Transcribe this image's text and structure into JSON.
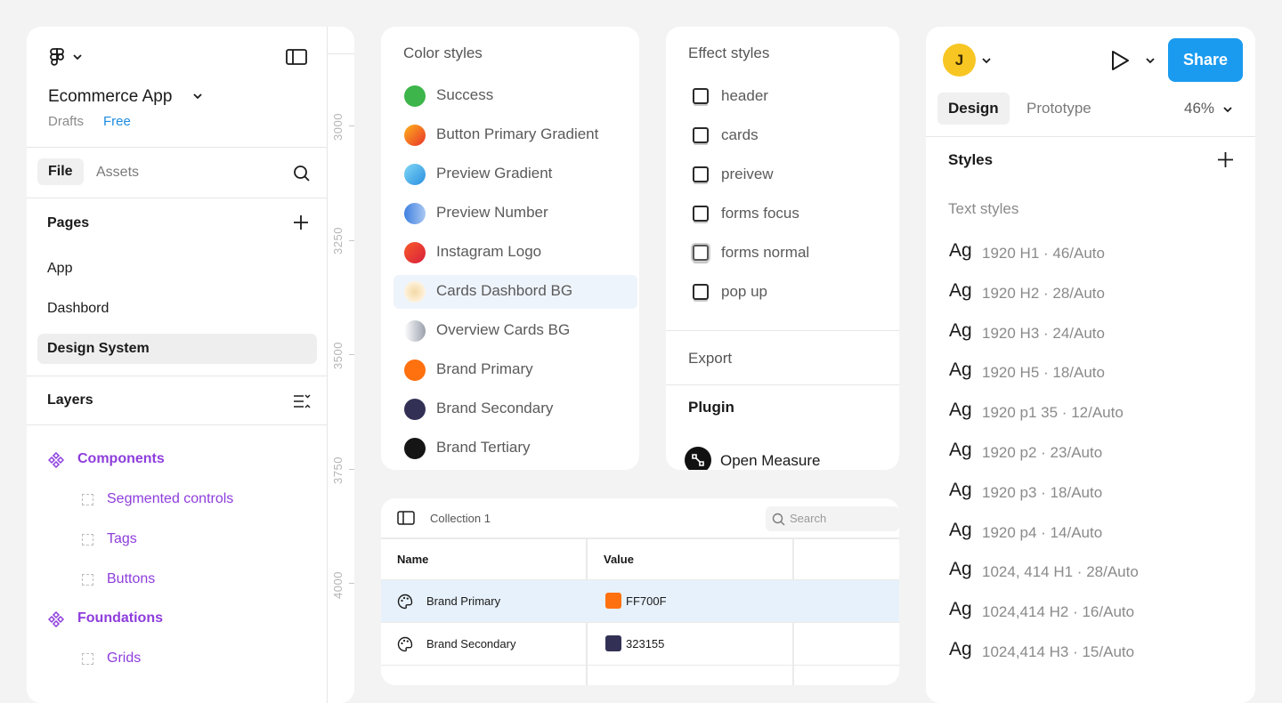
{
  "left_panel": {
    "project_title": "Ecommerce App",
    "location": "Drafts",
    "plan_badge": "Free",
    "tabs": {
      "file": "File",
      "assets": "Assets"
    },
    "pages_title": "Pages",
    "pages": [
      {
        "label": "App"
      },
      {
        "label": "Dashbord"
      },
      {
        "label": "Design System",
        "active": true
      }
    ],
    "layers_title": "Layers",
    "layers": [
      {
        "label": "Components",
        "type": "component"
      },
      {
        "label": "Segmented controls",
        "type": "frame"
      },
      {
        "label": "Tags",
        "type": "frame"
      },
      {
        "label": "Buttons",
        "type": "frame"
      },
      {
        "label": "Foundations",
        "type": "component"
      },
      {
        "label": "Grids",
        "type": "frame"
      }
    ],
    "ruler_labels": [
      "3000",
      "3250",
      "3500",
      "3750",
      "4000"
    ]
  },
  "color_styles": {
    "title": "Color styles",
    "items": [
      {
        "label": "Success",
        "color": "#3db54a"
      },
      {
        "label": "Button Primary Gradient",
        "color": "#f05a22"
      },
      {
        "label": "Preview Gradient",
        "color": "#3aa8e8"
      },
      {
        "label": "Preview Number",
        "color": "#4a8ee0"
      },
      {
        "label": "Instagram Logo",
        "color": "#e8332b"
      },
      {
        "label": "Cards Dashbord BG",
        "color": "#f3d9a6",
        "highlighted": true
      },
      {
        "label": "Overview Cards BG",
        "color": "#b9bcc6"
      },
      {
        "label": "Brand Primary",
        "color": "#ff700f"
      },
      {
        "label": "Brand Secondary",
        "color": "#323155"
      },
      {
        "label": "Brand Tertiary",
        "color": "#151515"
      }
    ]
  },
  "effect_styles": {
    "title": "Effect styles",
    "items": [
      {
        "label": "header"
      },
      {
        "label": "cards"
      },
      {
        "label": "preivew"
      },
      {
        "label": "forms focus"
      },
      {
        "label": "forms normal"
      },
      {
        "label": "pop up"
      }
    ],
    "export_label": "Export",
    "plugin_title": "Plugin",
    "plugin_name": "Open Measure"
  },
  "collection": {
    "title": "Collection 1",
    "search_placeholder": "Search",
    "columns": [
      "Name",
      "Value"
    ],
    "rows": [
      {
        "name": "Brand Primary",
        "value": "FF700F",
        "color": "#ff700f",
        "selected": true
      },
      {
        "name": "Brand Secondary",
        "value": "323155",
        "color": "#323155"
      }
    ]
  },
  "design_panel": {
    "avatar_initial": "J",
    "share_label": "Share",
    "tabs": {
      "design": "Design",
      "prototype": "Prototype"
    },
    "zoom": "46%",
    "styles_title": "Styles",
    "text_styles_title": "Text styles",
    "text_style_sample": "Ag",
    "text_styles": [
      "1920 H1 · 46/Auto",
      "1920 H2 · 28/Auto",
      "1920 H3 · 24/Auto",
      "1920 H5 · 18/Auto",
      "1920 p1 35 · 12/Auto",
      "1920 p2 · 23/Auto",
      "1920 p3 · 18/Auto",
      "1920 p4 · 14/Auto",
      "1024, 414 H1 · 28/Auto",
      "1024,414 H2 · 16/Auto",
      "1024,414 H3 · 15/Auto"
    ]
  },
  "accent_colors": {
    "share": "#1a9bf0",
    "layer_purple": "#8e3ddc",
    "free_badge": "#1d8ce0"
  }
}
